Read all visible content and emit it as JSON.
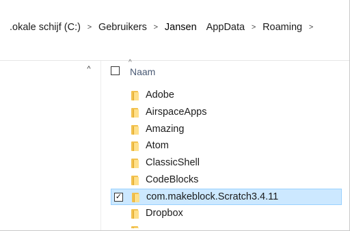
{
  "breadcrumb": {
    "items": [
      {
        "label": ".okale schijf (C:)"
      },
      {
        "label": "Gebruikers"
      },
      {
        "label": "Jansen"
      },
      {
        "label": "AppData"
      },
      {
        "label": "Roaming"
      }
    ],
    "separator": ">"
  },
  "nav_pane": {
    "scroll_up_glyph": "^"
  },
  "columns": {
    "name_header": "Naam",
    "sort_glyph": "^"
  },
  "files": [
    {
      "name": "Adobe",
      "selected": false,
      "checked": false
    },
    {
      "name": "AirspaceApps",
      "selected": false,
      "checked": false
    },
    {
      "name": "Amazing",
      "selected": false,
      "checked": false
    },
    {
      "name": "Atom",
      "selected": false,
      "checked": false
    },
    {
      "name": "ClassicShell",
      "selected": false,
      "checked": false
    },
    {
      "name": "CodeBlocks",
      "selected": false,
      "checked": false
    },
    {
      "name": "com.makeblock.Scratch3.4.11",
      "selected": true,
      "checked": true
    },
    {
      "name": "Dropbox",
      "selected": false,
      "checked": false
    }
  ],
  "colors": {
    "selection_bg": "#cce8ff",
    "selection_border": "#99d1ff",
    "folder_yellow": "#f2c14e",
    "header_text": "#4a5a74"
  }
}
